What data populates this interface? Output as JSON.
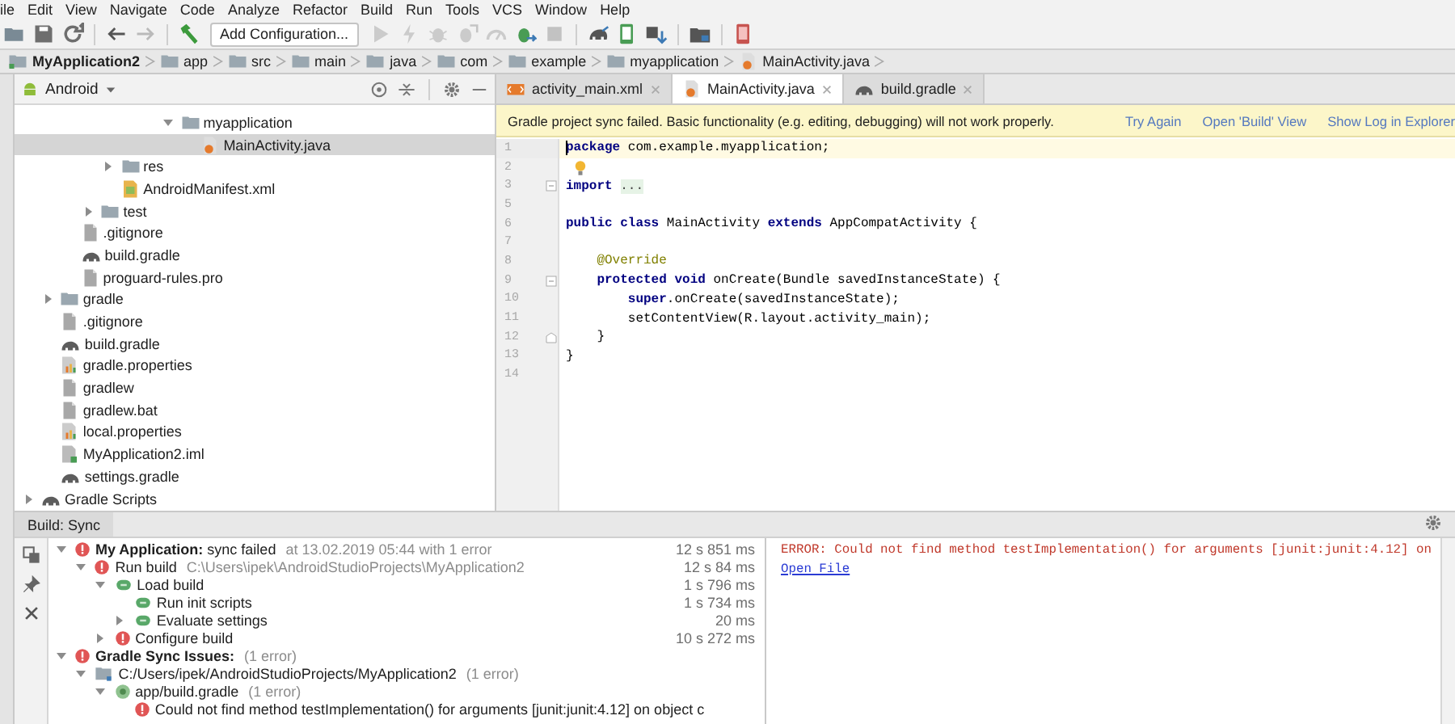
{
  "menu": [
    "ile",
    "Edit",
    "View",
    "Navigate",
    "Code",
    "Analyze",
    "Refactor",
    "Build",
    "Run",
    "Tools",
    "VCS",
    "Window",
    "Help"
  ],
  "toolbar": [
    {
      "kind": "open",
      "disabled": false
    },
    {
      "kind": "save",
      "disabled": false
    },
    {
      "kind": "sync",
      "disabled": false
    },
    {
      "kind": "sep"
    },
    {
      "kind": "back",
      "disabled": false
    },
    {
      "kind": "forward",
      "disabled": true
    },
    {
      "kind": "sep"
    },
    {
      "kind": "make",
      "disabled": false
    },
    {
      "kind": "config",
      "label": "Add Configuration..."
    },
    {
      "kind": "run",
      "disabled": true
    },
    {
      "kind": "apply",
      "disabled": true
    },
    {
      "kind": "debug",
      "disabled": true
    },
    {
      "kind": "attach",
      "disabled": true
    },
    {
      "kind": "profile",
      "disabled": true
    },
    {
      "kind": "apply-changes",
      "disabled": false
    },
    {
      "kind": "stop",
      "disabled": true
    },
    {
      "kind": "sep"
    },
    {
      "kind": "gradle-sync",
      "disabled": false
    },
    {
      "kind": "avd",
      "disabled": false
    },
    {
      "kind": "sdk",
      "disabled": false
    },
    {
      "kind": "sep"
    },
    {
      "kind": "structure",
      "disabled": false
    },
    {
      "kind": "sep"
    },
    {
      "kind": "device",
      "disabled": false
    }
  ],
  "breadcrumb": [
    {
      "label": "MyApplication2",
      "kind": "module"
    },
    {
      "label": "app",
      "kind": "folder"
    },
    {
      "label": "src",
      "kind": "folder"
    },
    {
      "label": "main",
      "kind": "folder"
    },
    {
      "label": "java",
      "kind": "folder"
    },
    {
      "label": "com",
      "kind": "folder"
    },
    {
      "label": "example",
      "kind": "folder"
    },
    {
      "label": "myapplication",
      "kind": "folder"
    },
    {
      "label": "MainActivity.java",
      "kind": "java"
    }
  ],
  "project_panel": {
    "view": "Android",
    "tree": [
      {
        "children": [
          {
            "children": [
              {
                "children": [
                  {
                    "children": [
                      {
                        "children": [
                          {
                            "children": [
                              {
                                "children": [
                                  {
                                    "label": "myapplication",
                                    "kind": "folder",
                                    "expanded": true,
                                    "selected": false,
                                    "children": [
                                      {
                                        "label": "MainActivity.java",
                                        "kind": "java",
                                        "selected": true
                                      }
                                    ]
                                  }
                                ]
                              }
                            ]
                          }
                        ]
                      },
                      {
                        "label": "res",
                        "kind": "folder",
                        "expanded": false,
                        "selected": false
                      },
                      {
                        "label": "AndroidManifest.xml",
                        "kind": "manifest",
                        "selected": false
                      }
                    ]
                  },
                  {
                    "label": "test",
                    "kind": "folder",
                    "expanded": false,
                    "selected": false
                  }
                ]
              },
              {
                "label": ".gitignore",
                "kind": "file",
                "selected": false
              },
              {
                "label": "build.gradle",
                "kind": "gradle",
                "selected": false
              },
              {
                "label": "proguard-rules.pro",
                "kind": "file",
                "selected": false
              }
            ]
          },
          {
            "label": "gradle",
            "kind": "folder",
            "expanded": false,
            "selected": false
          },
          {
            "label": ".gitignore",
            "kind": "file",
            "selected": false
          },
          {
            "label": "build.gradle",
            "kind": "gradle",
            "selected": false
          },
          {
            "label": "gradle.properties",
            "kind": "properties",
            "selected": false
          },
          {
            "label": "gradlew",
            "kind": "file",
            "selected": false
          },
          {
            "label": "gradlew.bat",
            "kind": "file",
            "selected": false
          },
          {
            "label": "local.properties",
            "kind": "properties",
            "selected": false
          },
          {
            "label": "MyApplication2.iml",
            "kind": "iml",
            "selected": false
          },
          {
            "label": "settings.gradle",
            "kind": "gradle",
            "selected": false
          }
        ]
      },
      {
        "label": "Gradle Scripts",
        "kind": "gradle",
        "expanded": false,
        "selected": false
      }
    ]
  },
  "editor": {
    "tabs": [
      {
        "label": "activity_main.xml",
        "kind": "xml",
        "selected": false
      },
      {
        "label": "MainActivity.java",
        "kind": "java",
        "selected": true
      },
      {
        "label": "build.gradle",
        "kind": "gradle",
        "selected": false
      }
    ],
    "notification": {
      "message": "Gradle project sync failed. Basic functionality (e.g. editing, debugging) will not work properly.",
      "actions": [
        "Try Again",
        "Open 'Build' View",
        "Show Log in Explorer"
      ]
    },
    "lines": [
      {
        "number": "1",
        "current": true,
        "bulb": false,
        "fold_start": false,
        "fold_end": false,
        "tokens": [
          {
            "kind": "keyword",
            "text": "package"
          },
          {
            "kind": "plain",
            "text": " com.example.myapplication;"
          }
        ]
      },
      {
        "number": "2",
        "current": false,
        "bulb": true,
        "fold_start": false,
        "fold_end": false
      },
      {
        "number": "3",
        "current": false,
        "bulb": false,
        "fold_start": true,
        "fold_end": false,
        "tokens": [
          {
            "kind": "keyword",
            "text": "import "
          },
          {
            "kind": "folded",
            "text": "..."
          }
        ]
      },
      {
        "number": "5",
        "current": false,
        "bulb": false,
        "fold_start": false,
        "fold_end": false
      },
      {
        "number": "6",
        "current": false,
        "bulb": false,
        "fold_start": false,
        "fold_end": false,
        "tokens": [
          {
            "kind": "keyword",
            "text": "public class"
          },
          {
            "kind": "plain",
            "text": " MainActivity "
          },
          {
            "kind": "keyword",
            "text": "extends"
          },
          {
            "kind": "plain",
            "text": " AppCompatActivity {"
          }
        ]
      },
      {
        "number": "7",
        "current": false,
        "bulb": false,
        "fold_start": false,
        "fold_end": false
      },
      {
        "number": "8",
        "current": false,
        "bulb": false,
        "fold_start": false,
        "fold_end": false,
        "tokens": [
          {
            "kind": "annotation",
            "text": "    @Override"
          }
        ]
      },
      {
        "number": "9",
        "current": false,
        "bulb": false,
        "fold_start": true,
        "fold_end": false,
        "tokens": [
          {
            "kind": "keyword",
            "text": "    protected void"
          },
          {
            "kind": "plain",
            "text": " onCreate(Bundle savedInstanceState) {"
          }
        ]
      },
      {
        "number": "10",
        "current": false,
        "bulb": false,
        "fold_start": false,
        "fold_end": false,
        "tokens": [
          {
            "kind": "keyword",
            "text": "        super"
          },
          {
            "kind": "plain",
            "text": ".onCreate(savedInstanceState);"
          }
        ]
      },
      {
        "number": "11",
        "current": false,
        "bulb": false,
        "fold_start": false,
        "fold_end": false,
        "tokens": [
          {
            "kind": "plain",
            "text": "        setContentView(R.layout.activity_main);"
          }
        ]
      },
      {
        "number": "12",
        "current": false,
        "bulb": false,
        "fold_start": false,
        "fold_end": true,
        "tokens": [
          {
            "kind": "plain",
            "text": "    }"
          }
        ]
      },
      {
        "number": "13",
        "current": false,
        "bulb": false,
        "fold_start": false,
        "fold_end": false,
        "tokens": [
          {
            "kind": "plain",
            "text": "}"
          }
        ]
      },
      {
        "number": "14",
        "current": false,
        "bulb": false,
        "fold_start": false,
        "fold_end": false
      }
    ]
  },
  "build_panel": {
    "title": "Build: Sync",
    "tree": [
      {
        "label": "**My Application:** sync failed",
        "note": "at 13.02.2019 05:44   with 1 error",
        "time": "12 s 851 ms",
        "kind": "error",
        "expanded": true,
        "children": [
          {
            "label": "Run build",
            "note": "C:\\Users\\ipek\\AndroidStudioProjects\\MyApplication2",
            "time": "12 s 84 ms",
            "kind": "error",
            "expanded": true,
            "children": [
              {
                "label": "Load build",
                "time": "1 s 796 ms",
                "kind": "ok",
                "expanded": true,
                "children": [
                  {
                    "label": "Run init scripts",
                    "time": "1 s 734 ms",
                    "kind": "ok"
                  },
                  {
                    "label": "Evaluate settings",
                    "time": "20 ms",
                    "kind": "ok",
                    "expanded": false
                  }
                ]
              },
              {
                "label": "Configure build",
                "time": "10 s 272 ms",
                "kind": "error",
                "expanded": false
              }
            ]
          }
        ]
      },
      {
        "label": "**Gradle Sync Issues:**",
        "note": "(1 error)",
        "kind": "error",
        "expanded": true,
        "children": [
          {
            "label": "C:/Users/ipek/AndroidStudioProjects/MyApplication2",
            "note": "(1 error)",
            "kind": "folder",
            "expanded": true,
            "children": [
              {
                "label": "app/build.gradle",
                "note": "(1 error)",
                "kind": "gradle",
                "expanded": true,
                "children": [
                  {
                    "label": "Could not find method testImplementation() for arguments [junit:junit:4.12] on object c",
                    "kind": "error"
                  }
                ]
              }
            ]
          }
        ]
      }
    ],
    "console": {
      "error": "ERROR: Could not find method testImplementation() for arguments [junit:junit:4.12] on",
      "link": "Open File"
    }
  }
}
